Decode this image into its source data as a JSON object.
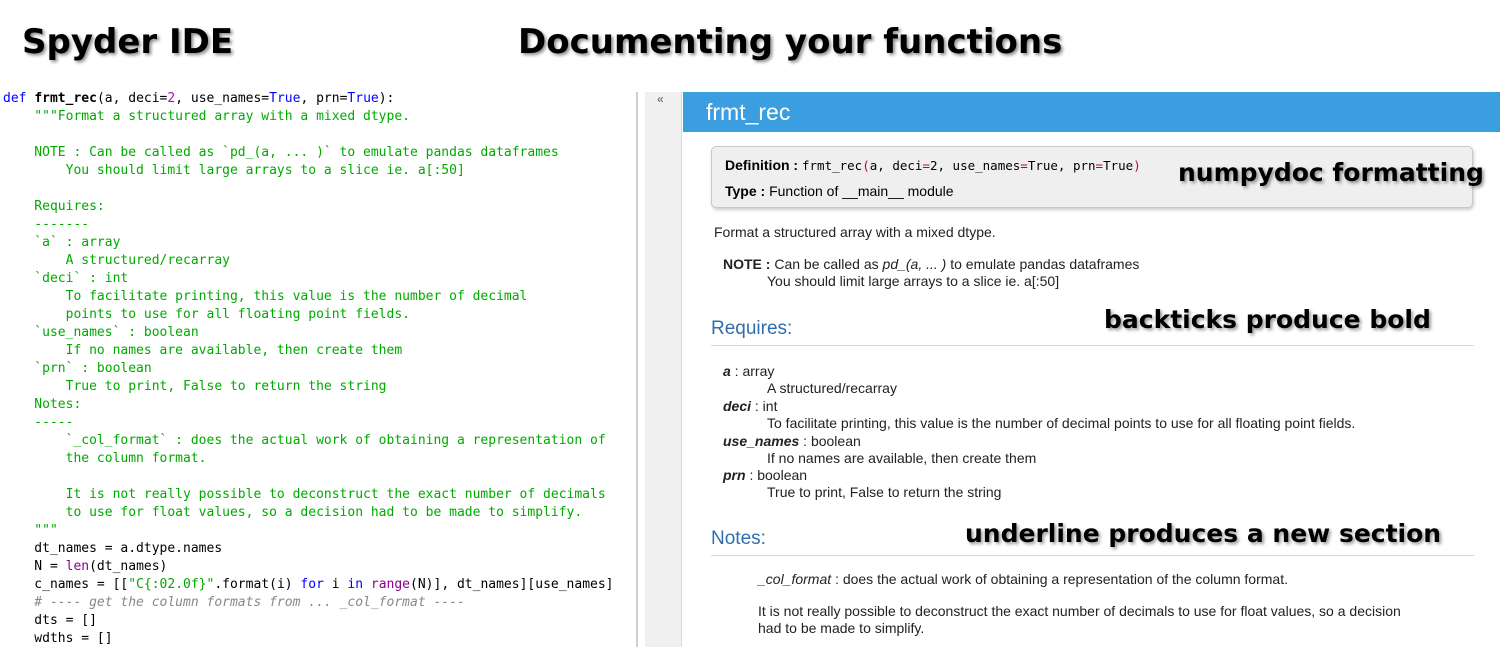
{
  "titles": {
    "left": "Spyder IDE",
    "center": "Documenting your functions"
  },
  "editor": {
    "lines": [
      [
        [
          "kw",
          "def "
        ],
        [
          "def",
          "frmt_rec"
        ],
        [
          "",
          "(a, deci="
        ],
        [
          "num",
          "2"
        ],
        [
          "",
          ", use_names="
        ],
        [
          "kw",
          "True"
        ],
        [
          "",
          ", prn="
        ],
        [
          "kw",
          "True"
        ],
        [
          "",
          "):"
        ]
      ],
      [
        [
          "doc",
          "    \"\"\"Format a structured array with a mixed dtype."
        ]
      ],
      [
        [
          "",
          ""
        ]
      ],
      [
        [
          "doc",
          "    NOTE : Can be called as `pd_(a, ... )` to emulate pandas dataframes"
        ]
      ],
      [
        [
          "doc",
          "        You should limit large arrays to a slice ie. a[:50]"
        ]
      ],
      [
        [
          "",
          ""
        ]
      ],
      [
        [
          "doc",
          "    Requires:"
        ]
      ],
      [
        [
          "doc",
          "    -------"
        ]
      ],
      [
        [
          "doc",
          "    `a` : array"
        ]
      ],
      [
        [
          "doc",
          "        A structured/recarray"
        ]
      ],
      [
        [
          "doc",
          "    `deci` : int"
        ]
      ],
      [
        [
          "doc",
          "        To facilitate printing, this value is the number of decimal"
        ]
      ],
      [
        [
          "doc",
          "        points to use for all floating point fields."
        ]
      ],
      [
        [
          "doc",
          "    `use_names` : boolean"
        ]
      ],
      [
        [
          "doc",
          "        If no names are available, then create them"
        ]
      ],
      [
        [
          "doc",
          "    `prn` : boolean"
        ]
      ],
      [
        [
          "doc",
          "        True to print, False to return the string"
        ]
      ],
      [
        [
          "doc",
          "    Notes:"
        ]
      ],
      [
        [
          "doc",
          "    -----"
        ]
      ],
      [
        [
          "doc",
          "        `_col_format` : does the actual work of obtaining a representation of"
        ]
      ],
      [
        [
          "doc",
          "        the column format."
        ]
      ],
      [
        [
          "",
          ""
        ]
      ],
      [
        [
          "doc",
          "        It is not really possible to deconstruct the exact number of decimals"
        ]
      ],
      [
        [
          "doc",
          "        to use for float values, so a decision had to be made to simplify."
        ]
      ],
      [
        [
          "doc",
          "    \"\"\""
        ]
      ],
      [
        [
          "",
          "    dt_names = a.dtype.names"
        ]
      ],
      [
        [
          "",
          "    N = "
        ],
        [
          "bi",
          "len"
        ],
        [
          "",
          "(dt_names)"
        ]
      ],
      [
        [
          "",
          "    c_names = [["
        ],
        [
          "str",
          "\"C{:02.0f}\""
        ],
        [
          "",
          ".format(i) "
        ],
        [
          "kw",
          "for"
        ],
        [
          "",
          " i "
        ],
        [
          "kw",
          "in"
        ],
        [
          "",
          ""
        ],
        [
          "bi",
          " range"
        ],
        [
          "",
          "(N)], dt_names][use_names]"
        ]
      ],
      [
        [
          "cm",
          "    # ---- get the column formats from ... _col_format ----"
        ]
      ],
      [
        [
          "",
          "    dts = []"
        ]
      ],
      [
        [
          "",
          "    wdths = []"
        ]
      ]
    ]
  },
  "gutter": {
    "caret": "«"
  },
  "help": {
    "header_title": "frmt_rec",
    "definition_label": "Definition :",
    "definition_parts": [
      [
        "",
        "frmt_rec"
      ],
      [
        "kwv",
        "("
      ],
      [
        "",
        "a, deci"
      ],
      [
        "kwv",
        "="
      ],
      [
        "",
        "2, use_names"
      ],
      [
        "kwv",
        "="
      ],
      [
        "",
        "True, prn"
      ],
      [
        "kwv",
        "="
      ],
      [
        "",
        "True"
      ],
      [
        "kwv",
        ")"
      ]
    ],
    "type_label": "Type :",
    "type_value": "Function of __main__ module",
    "summary": "Format a structured array with a mixed dtype.",
    "note_label": "NOTE :",
    "note_pre": "Can be called as ",
    "note_em": "pd_(a, ... )",
    "note_post": " to emulate pandas dataframes",
    "note_line2": "You should limit large arrays to a slice ie. a[:50]",
    "requires_heading": "Requires:",
    "params": [
      {
        "name": "a",
        "type": " : array",
        "desc": "A structured/recarray"
      },
      {
        "name": "deci",
        "type": " : int",
        "desc": "To facilitate printing, this value is the number of decimal points to use for all floating point fields."
      },
      {
        "name": "use_names",
        "type": " : boolean",
        "desc": "If no names are available, then create them"
      },
      {
        "name": "prn",
        "type": " : boolean",
        "desc": "True to print, False to return the string"
      }
    ],
    "notes_heading": "Notes:",
    "notes_item_em": "_col_format",
    "notes_item_text": " : does the actual work of obtaining a representation of the column format.",
    "notes_para_line1": "It is not really possible to deconstruct the exact number of decimals to use for float values, so a decision",
    "notes_para_line2": "had to be made to simplify."
  },
  "annotations": {
    "numpydoc": "numpydoc formatting",
    "backticks": "backticks produce bold",
    "underline": "underline produces a new section"
  }
}
